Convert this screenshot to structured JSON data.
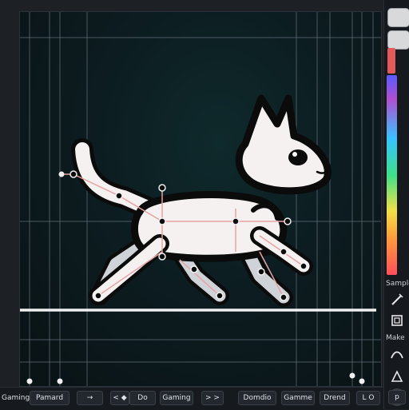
{
  "right_panel": {
    "label_1": "Sample",
    "label_2": "Make"
  },
  "bottom_bar": {
    "item_1": "Gaming",
    "item_2": "Pamard",
    "item_3": "→",
    "item_4": "< ◆",
    "item_5": "Do",
    "item_6": "Gaming",
    "item_7": "> >",
    "item_8": "Domdio",
    "item_9": "Gamme",
    "item_10": "Drend",
    "item_11": "L O",
    "item_12": "p"
  },
  "colors": {
    "canvas_bg": "#0c1c20",
    "outline": "#0b0b0b",
    "body": "#f6f1f1",
    "shade": "#cfd3d8",
    "bone": "#e2a4a4",
    "guide": "#8a96a3",
    "ground": "#f0f0f0",
    "accent_swatch": "#e25a5a"
  }
}
